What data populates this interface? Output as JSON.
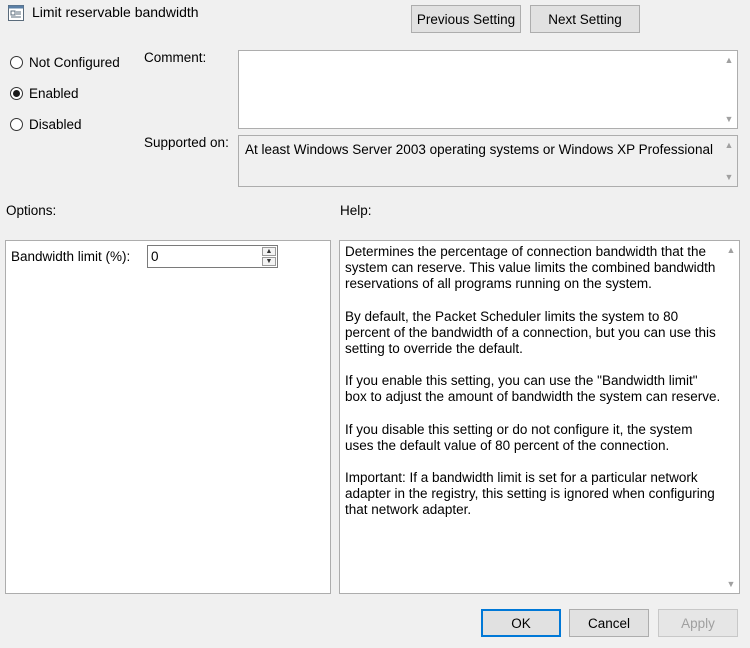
{
  "window": {
    "title": "Limit reservable bandwidth",
    "icon": "policy-setting-icon"
  },
  "nav": {
    "previous_label": "Previous Setting",
    "next_label": "Next Setting"
  },
  "state": {
    "options": [
      "Not Configured",
      "Enabled",
      "Disabled"
    ],
    "selected": "Enabled"
  },
  "comment": {
    "label": "Comment:",
    "value": ""
  },
  "supported": {
    "label": "Supported on:",
    "value": "At least Windows Server 2003 operating systems or Windows XP Professional"
  },
  "options_section": {
    "label": "Options:",
    "bandwidth": {
      "label": "Bandwidth limit (%):",
      "value": "0"
    }
  },
  "help_section": {
    "label": "Help:",
    "paragraphs": [
      "Determines the percentage of connection bandwidth that the system can reserve. This value limits the combined bandwidth reservations of all programs running on the system.",
      "By default, the Packet Scheduler limits the system to 80 percent of the bandwidth of a connection, but you can use this setting to override the default.",
      "If you enable this setting, you can use the \"Bandwidth limit\" box to adjust the amount of bandwidth the system can reserve.",
      "If you disable this setting or do not configure it, the system uses the default value of 80 percent of the connection.",
      "Important: If a bandwidth limit is set for a particular network adapter in the registry, this setting is ignored when configuring that network adapter."
    ]
  },
  "footer": {
    "ok_label": "OK",
    "cancel_label": "Cancel",
    "apply_label": "Apply"
  }
}
